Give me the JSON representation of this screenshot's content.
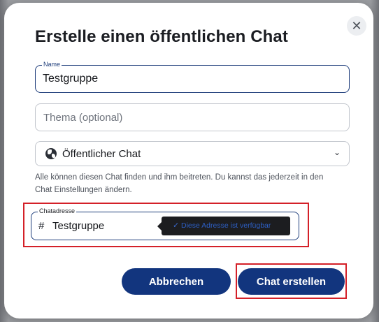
{
  "dialog": {
    "title": "Erstelle einen öffentlichen Chat",
    "close_icon": "close-icon",
    "close_glyph": "✕"
  },
  "form": {
    "name": {
      "label": "Name",
      "value": "Testgruppe"
    },
    "topic": {
      "placeholder": "Thema (optional)",
      "value": ""
    },
    "visibility": {
      "icon": "globe-icon",
      "selected": "Öffentlicher Chat",
      "chevron_glyph": "⌄"
    },
    "hint": "Alle können diesen Chat finden und ihm beitreten. Du kannst das jederzeit in den Chat Einstellungen ändern.",
    "address": {
      "label": "Chatadresse",
      "prefix": "#",
      "value": "Testgruppe",
      "tooltip_icon": "check-icon",
      "tooltip_check_glyph": "✓",
      "tooltip": "Diese Adresse ist verfügbar"
    }
  },
  "actions": {
    "cancel_label": "Abbrechen",
    "create_label": "Chat erstellen"
  },
  "colors": {
    "primary_button": "#12357e",
    "highlight_frame": "#d42028",
    "focus_border": "#1d3c7a"
  }
}
